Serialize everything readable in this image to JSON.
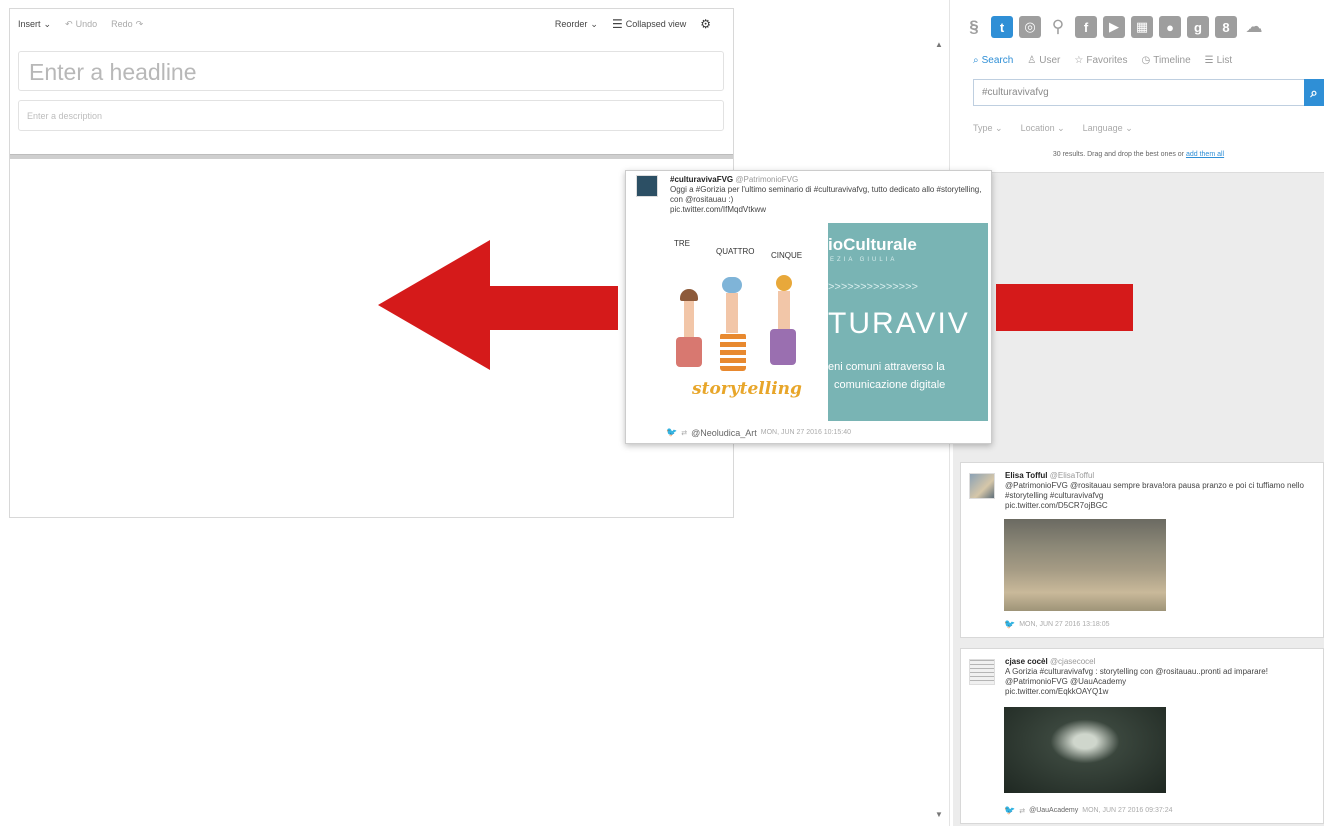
{
  "editor": {
    "toolbar": {
      "insert": "Insert",
      "undo": "Undo",
      "redo": "Redo",
      "reorder": "Reorder",
      "collapsed_view": "Collapsed view"
    },
    "headline_placeholder": "Enter a headline",
    "description_placeholder": "Enter a description"
  },
  "sources": {
    "services": [
      "storify-icon",
      "twitter-icon",
      "instagram-icon",
      "link-icon",
      "facebook-icon",
      "youtube-icon",
      "flickr-icon",
      "giphy-icon",
      "google-icon",
      "google-plus-icon",
      "soundcloud-icon"
    ],
    "tabs": [
      "Search",
      "User",
      "Favorites",
      "Timeline",
      "List"
    ],
    "search": {
      "value": "#culturavivafvg"
    },
    "filters": {
      "type": "Type",
      "location": "Location",
      "language": "Language"
    },
    "results_note": {
      "text": "30 results. Drag and drop the best ones or",
      "link": "add them all"
    }
  },
  "dragged_tweet": {
    "name": "#culturavivaFVG",
    "handle": "@PatrimonioFVG",
    "text": "Oggi a #Gorizia per l'ultimo seminario di #culturavivafvg, tutto dedicato allo #storytelling, con @rositauau :)",
    "link": "pic.twitter.com/IfMqdVtkww",
    "image": {
      "left_words": [
        "TRE",
        "QUATTRO",
        "CINQUE"
      ],
      "left_caption": "storytelling",
      "right_title": "ioCulturale",
      "right_sub": "EZIA GIULIA",
      "right_arrows": ">>>>>>>>>>>>>>",
      "right_big": "TURAVIV",
      "right_line1": "eni comuni attraverso la",
      "right_line2": "comunicazione digitale"
    },
    "via": "@Neoludica_Art",
    "date": "MON, JUN 27 2016 10:15:40"
  },
  "tweets": [
    {
      "name": "Elisa Tofful",
      "handle": "@ElisaTofful",
      "text": "@PatrimonioFVG @rositauau sempre brava!ora pausa pranzo e poi ci tuffiamo nello #storytelling #culturavivafvg",
      "link": "pic.twitter.com/D5CR7ojBGC",
      "date": "MON, JUN 27 2016 13:18:05"
    },
    {
      "name": "cjase cocèl",
      "handle": "@cjasecocel",
      "text": "A Gorizia #culturavivafvg : storytelling con @rositauau..pronti ad imparare! @PatrimonioFVG @UauAcademy",
      "link": "pic.twitter.com/EqkkOAYQ1w",
      "via": "@UauAcademy",
      "date": "MON, JUN 27 2016 09:37:24"
    }
  ],
  "colors": {
    "accent": "#2f8fd6",
    "arrow": "#d51a1a"
  }
}
